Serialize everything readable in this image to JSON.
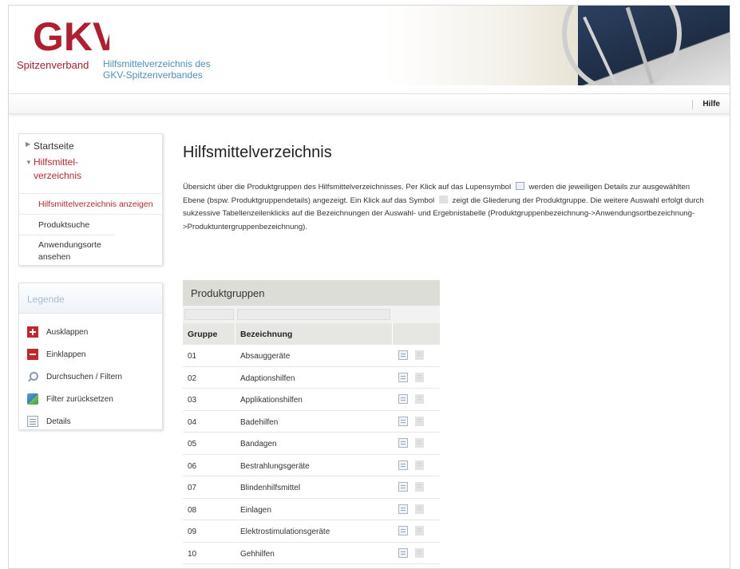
{
  "header": {
    "logo_text": "GKV",
    "brand": "Spitzenverband",
    "subtitle_line1": "Hilfsmittelverzeichnis des",
    "subtitle_line2": "GKV-Spitzenverbandes",
    "help_label": "Hilfe"
  },
  "nav": {
    "start": "Startseite",
    "section_line1": "Hilfsmittel-",
    "section_line2": "verzeichnis",
    "items": [
      {
        "label": "Hilfsmittelverzeichnis anzeigen",
        "active": true
      },
      {
        "label": "Produktsuche",
        "active": false
      },
      {
        "label": "Anwendungsorte ansehen",
        "active": false
      }
    ]
  },
  "legend": {
    "title": "Legende",
    "items": [
      {
        "icon": "expand-icon",
        "label": "Ausklappen"
      },
      {
        "icon": "collapse-icon",
        "label": "Einklappen"
      },
      {
        "icon": "search-icon",
        "label": "Durchsuchen / Filtern"
      },
      {
        "icon": "reset-filter-icon",
        "label": "Filter zurücksetzen"
      },
      {
        "icon": "details-icon",
        "label": "Details"
      }
    ]
  },
  "main": {
    "title": "Hilfsmittelverzeichnis",
    "intro_part1": "Übersicht über die Produktgruppen des Hilfsmittelverzeichnisses. Per Klick auf das Lupensymbol",
    "intro_part2": "werden die jeweiligen Details zur ausgewählten Ebene (bspw. Produktgruppendetails) angezeigt. Ein Klick auf das Symbol",
    "intro_part3": "zeigt die Gliederung der Produktgruppe. Die weitere Auswahl erfolgt durch sukzessive Tabellenzeilenklicks auf die Bezeichnungen der Auswahl- und Ergebnistabelle (Produktgruppenbezeichnung->Anwendungsortbezeichnung->Produktuntergruppenbezeichnung)."
  },
  "table": {
    "caption": "Produktgruppen",
    "col_group": "Gruppe",
    "col_name": "Bezeichnung",
    "rows": [
      {
        "group": "01",
        "name": "Absauggeräte"
      },
      {
        "group": "02",
        "name": "Adaptionshilfen"
      },
      {
        "group": "03",
        "name": "Applikationshilfen"
      },
      {
        "group": "04",
        "name": "Badehilfen"
      },
      {
        "group": "05",
        "name": "Bandagen"
      },
      {
        "group": "06",
        "name": "Bestrahlungsgeräte"
      },
      {
        "group": "07",
        "name": "Blindenhilfsmittel"
      },
      {
        "group": "08",
        "name": "Einlagen"
      },
      {
        "group": "09",
        "name": "Elektrostimulationsgeräte"
      },
      {
        "group": "10",
        "name": "Gehhilfen"
      }
    ]
  }
}
